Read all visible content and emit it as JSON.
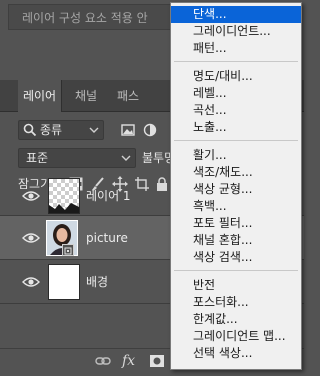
{
  "properties_panel": {
    "description_text": "레이어 구성 요소 적용 안"
  },
  "layers_panel": {
    "tabs": [
      {
        "label": "레이어"
      },
      {
        "label": "채널"
      },
      {
        "label": "패스"
      }
    ],
    "filter": {
      "label": "종류",
      "icon": "search-icon"
    },
    "blend_mode": {
      "value": "표준"
    },
    "opacity_label": "불투명",
    "lock_label": "잠그기:",
    "layers": [
      {
        "name": "레이어 1",
        "visible": true,
        "thumbnail": "transparent"
      },
      {
        "name": "picture",
        "visible": true,
        "thumbnail": "photo",
        "selected": true
      },
      {
        "name": "배경",
        "visible": true,
        "thumbnail": "white"
      }
    ]
  },
  "adjustment_menu": {
    "groups": [
      {
        "items": [
          "단색...",
          "그레이디언트...",
          "패턴..."
        ]
      },
      {
        "items": [
          "명도/대비...",
          "레벨...",
          "곡선...",
          "노출..."
        ]
      },
      {
        "items": [
          "활기...",
          "색조/채도...",
          "색상 균형...",
          "흑백...",
          "포토 필터...",
          "채널 혼합...",
          "색상 검색..."
        ]
      },
      {
        "items": [
          "반전",
          "포스터화...",
          "한계값...",
          "그레이디언트 맵...",
          "선택 색상..."
        ]
      }
    ],
    "highlighted_item": "단색..."
  },
  "colors": {
    "panel_bg": "#535353",
    "tab_bar_bg": "#424242",
    "menu_bg": "#f0f0f0",
    "menu_highlight": "#0a64d8",
    "selected_layer_bg": "#636363"
  }
}
